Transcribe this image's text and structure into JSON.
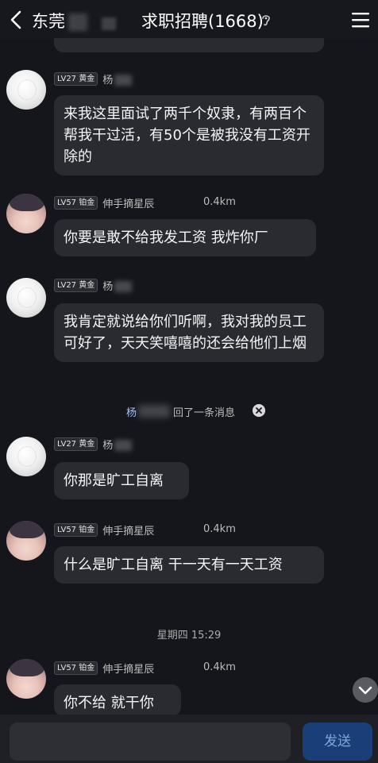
{
  "header": {
    "title_left": "东莞",
    "title_right": "求职招聘(1668)"
  },
  "messages": [
    {
      "badge": "LV27 黄金",
      "username": "杨",
      "distance": "",
      "text": "来我这里面试了两千个奴隶，有两百个帮我干过活，有50个是被我没有工资开除的"
    },
    {
      "badge": "LV57 铂金",
      "username": "伸手摘星辰",
      "distance": "0.4km",
      "text": "你要是敢不给我发工资  我炸你厂"
    },
    {
      "badge": "LV27 黄金",
      "username": "杨",
      "distance": "",
      "text": "我肯定就说给你们听啊，我对我的员工可好了，天天笑嘻嘻的还会给他们上烟"
    },
    {
      "badge": "LV27 黄金",
      "username": "杨",
      "distance": "",
      "text": "你那是旷工自离"
    },
    {
      "badge": "LV57 铂金",
      "username": "伸手摘星辰",
      "distance": "0.4km",
      "text": "什么是旷工自离  干一天有一天工资"
    },
    {
      "badge": "LV57 铂金",
      "username": "伸手摘星辰",
      "distance": "0.4km",
      "text": "你不给  就干你"
    }
  ],
  "recall_notice": {
    "name": "杨",
    "text": "回了一条消息"
  },
  "timestamp": "星期四 15:29",
  "composer": {
    "send_label": "发送"
  },
  "colors": {
    "background": "#15161b",
    "bubble": "#2a2b31",
    "send_button": "#1a3f78"
  }
}
